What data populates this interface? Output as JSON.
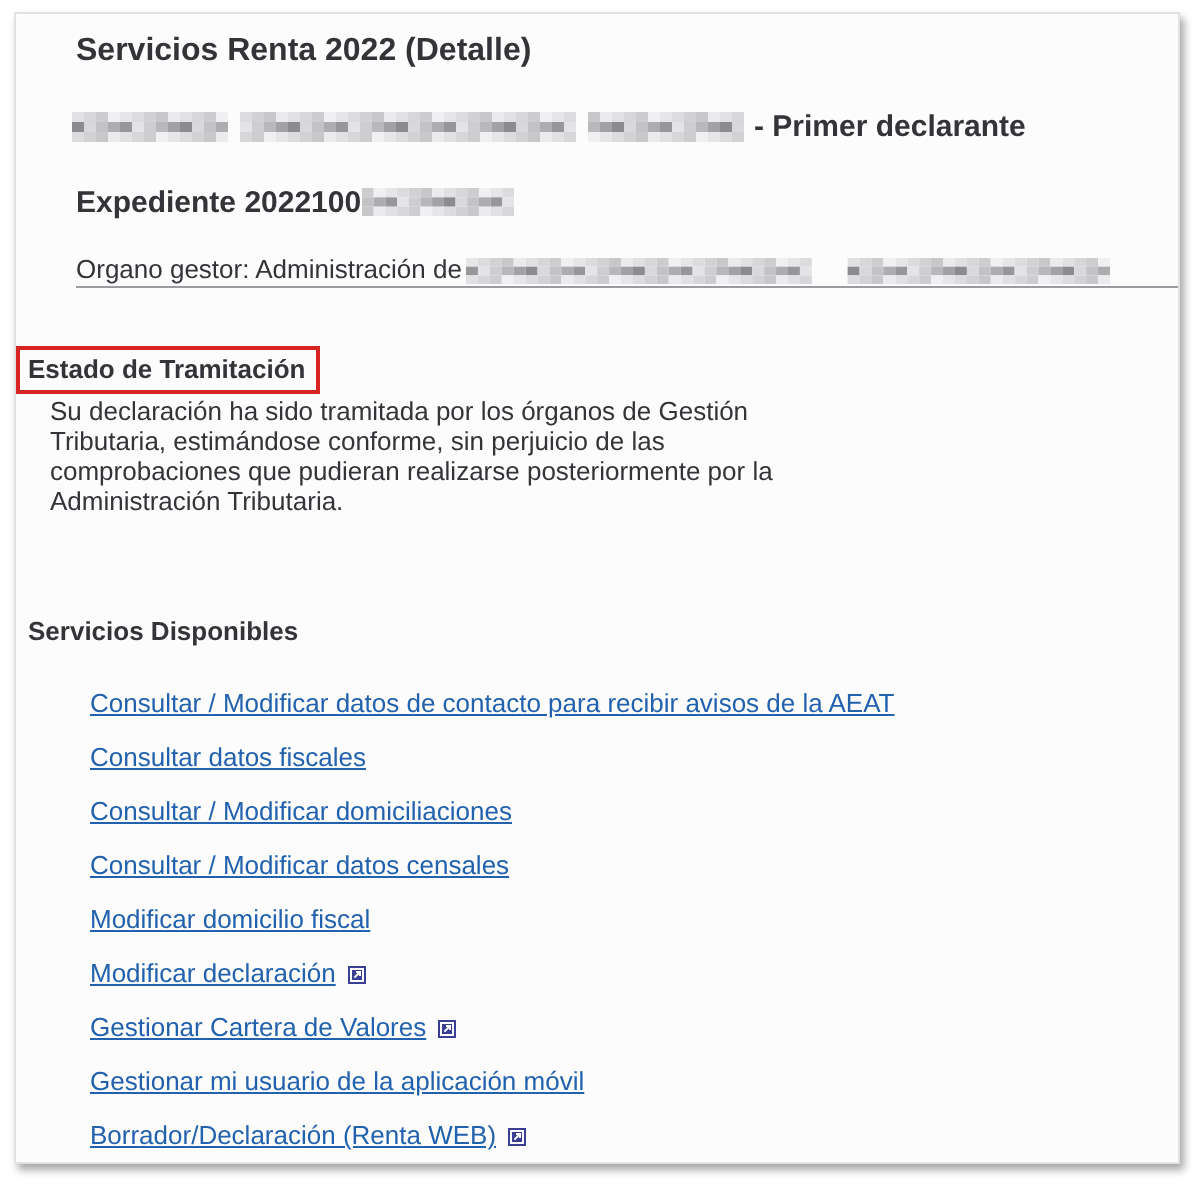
{
  "page_title": "Servicios Renta 2022 (Detalle)",
  "declarant": {
    "name_redacted": true,
    "role": "- Primer declarante"
  },
  "file": {
    "label": "Expediente 2022100",
    "number_redacted": true
  },
  "office": {
    "label": "Organo gestor: Administración de",
    "name_redacted": true
  },
  "status_section": {
    "heading": "Estado de Tramitación",
    "highlighted": true,
    "text": "Su declaración ha sido tramitada por los órganos de Gestión Tributaria, estimándose conforme, sin perjuicio de las comprobaciones que pudieran realizarse posteriormente por la Administración Tributaria."
  },
  "services_section": {
    "heading": "Servicios Disponibles",
    "links": [
      {
        "label": "Consultar / Modificar datos de contacto para recibir avisos de la AEAT",
        "external": false
      },
      {
        "label": "Consultar datos fiscales",
        "external": false
      },
      {
        "label": "Consultar / Modificar domiciliaciones",
        "external": false
      },
      {
        "label": "Consultar / Modificar datos censales",
        "external": false
      },
      {
        "label": "Modificar domicilio fiscal",
        "external": false
      },
      {
        "label": "Modificar declaración",
        "external": true
      },
      {
        "label": "Gestionar Cartera de Valores",
        "external": true
      },
      {
        "label": "Gestionar mi usuario de la aplicación móvil",
        "external": false
      },
      {
        "label": "Borrador/Declaración (Renta WEB)",
        "external": true
      }
    ]
  }
}
